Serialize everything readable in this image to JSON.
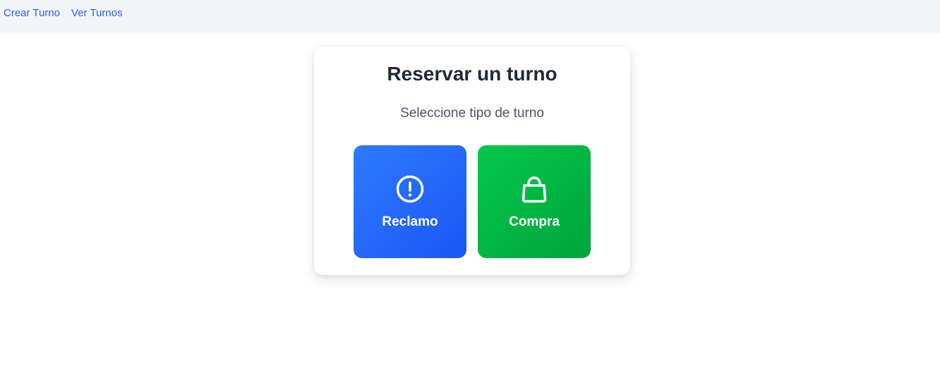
{
  "nav": {
    "links": [
      {
        "label": "Crear Turno"
      },
      {
        "label": "Ver Turnos"
      }
    ],
    "link_color": "#2563eb",
    "background": "#f3f4f6"
  },
  "card": {
    "title": "Reservar un turno",
    "subtitle": "Seleccione tipo de turno",
    "options": [
      {
        "label": "Reclamo",
        "icon": "exclamation-circle-icon",
        "color": "#2563eb"
      },
      {
        "label": "Compra",
        "icon": "shopping-bag-icon",
        "color": "#00b341"
      }
    ]
  }
}
